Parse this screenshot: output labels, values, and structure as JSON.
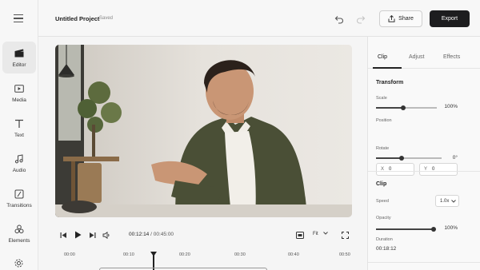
{
  "rail": {
    "items": [
      {
        "label": "Editor",
        "icon": "clapperboard-icon"
      },
      {
        "label": "Media",
        "icon": "folder-icon"
      },
      {
        "label": "Text",
        "icon": "text-icon"
      },
      {
        "label": "Audio",
        "icon": "music-note-icon"
      },
      {
        "label": "Transitions",
        "icon": "transition-icon"
      },
      {
        "label": "Elements",
        "icon": "shapes-icon"
      }
    ]
  },
  "header": {
    "project_title": "Untitled Project",
    "save_status": "Saved",
    "share_label": "Share",
    "export_label": "Export"
  },
  "player": {
    "current_time": "00:12:14",
    "separator": "/",
    "total_time": "00:45:00",
    "fit_label": "Fit"
  },
  "timeline": {
    "ticks": [
      "00:00",
      "00:10",
      "00:20",
      "00:30",
      "00:40",
      "00:50"
    ],
    "playhead_time": "00:12:14"
  },
  "panel": {
    "tabs": [
      "Clip",
      "Adjust",
      "Effects"
    ],
    "active_tab": "Clip",
    "transform": {
      "title": "Transform",
      "scale_label": "Scale",
      "scale_value": "100%",
      "scale_level": 0.45,
      "position_label": "Position",
      "x_key": "X",
      "x_value": "0",
      "y_key": "Y",
      "y_value": "0",
      "rotate_label": "Rotate",
      "rotate_value": "0°",
      "rotate_level": 0.42
    },
    "clip": {
      "title": "Clip",
      "speed_label": "Speed",
      "speed_value": "1.0x",
      "opacity_label": "Opacity",
      "opacity_value": "100%",
      "opacity_level": 1.0,
      "duration_label": "Duration",
      "duration_value": "00:18:12"
    }
  }
}
